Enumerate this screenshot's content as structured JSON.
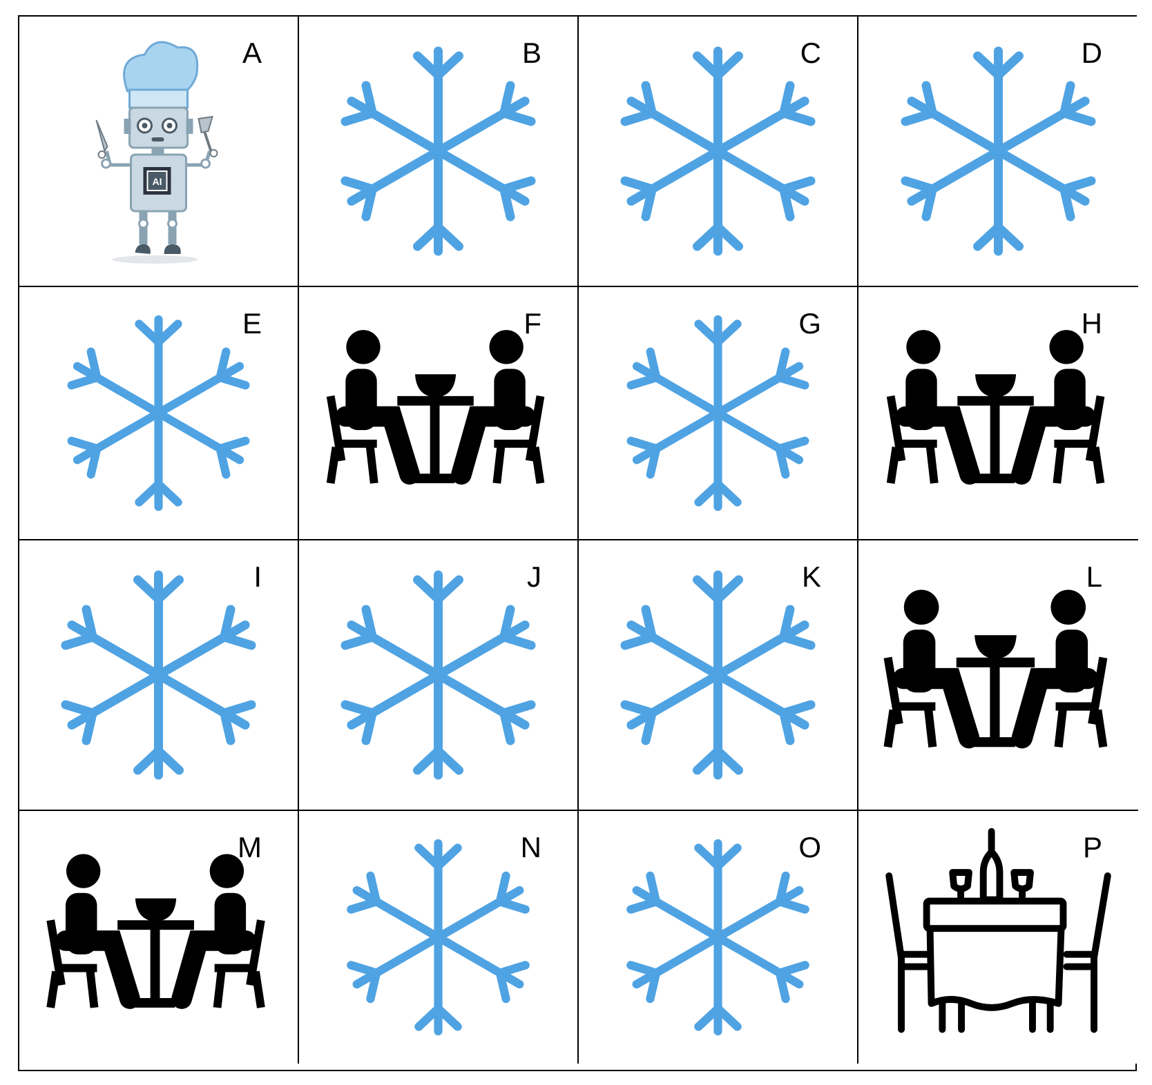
{
  "colors": {
    "snowflake": "#4fa3e3",
    "silhouette": "#000000",
    "robot_hat": "#a9d4f0",
    "robot_body": "#c9d8e2"
  },
  "cells": [
    {
      "label": "A",
      "icon": "robot-chef-icon"
    },
    {
      "label": "B",
      "icon": "snowflake-icon"
    },
    {
      "label": "C",
      "icon": "snowflake-icon"
    },
    {
      "label": "D",
      "icon": "snowflake-icon"
    },
    {
      "label": "E",
      "icon": "snowflake-icon"
    },
    {
      "label": "F",
      "icon": "people-at-table-icon"
    },
    {
      "label": "G",
      "icon": "snowflake-icon"
    },
    {
      "label": "H",
      "icon": "people-at-table-icon"
    },
    {
      "label": "I",
      "icon": "snowflake-icon"
    },
    {
      "label": "J",
      "icon": "snowflake-icon"
    },
    {
      "label": "K",
      "icon": "snowflake-icon"
    },
    {
      "label": "L",
      "icon": "people-at-table-icon"
    },
    {
      "label": "M",
      "icon": "people-at-table-icon"
    },
    {
      "label": "N",
      "icon": "snowflake-icon"
    },
    {
      "label": "O",
      "icon": "snowflake-icon"
    },
    {
      "label": "P",
      "icon": "dining-table-icon"
    }
  ]
}
